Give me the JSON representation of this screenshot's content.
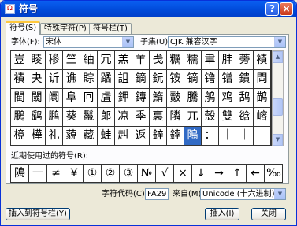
{
  "window": {
    "title": "符号"
  },
  "tabs": [
    {
      "label": "符号(S)"
    },
    {
      "label": "特殊字符(P)"
    },
    {
      "label": "符号栏(T)"
    }
  ],
  "font": {
    "label": "字体(F):",
    "value": "宋体"
  },
  "subset": {
    "label": "子集(U):",
    "value": "CJK 兼容汉字"
  },
  "grid": [
    [
      "豈",
      "睖",
      "穇",
      "竺",
      "紬",
      "冗",
      "羔",
      "羊",
      "戋",
      "糲",
      "糯",
      "聿",
      "肨",
      "蒡",
      "襀"
    ],
    [
      "襀",
      "夬",
      "䜣",
      "谯",
      "賩",
      "蹫",
      "詛",
      "鏑",
      "鈨",
      "铵",
      "镝",
      "镥",
      "镨",
      "鐀",
      "閊"
    ],
    [
      "閵",
      "閾",
      "阛",
      "阜",
      "冋",
      "虘",
      "鉀",
      "鏄",
      "鰖",
      "皾",
      "騰",
      "鸼",
      "鸡",
      "鸹",
      "鹋"
    ],
    [
      "鵩",
      "鹞",
      "鹏",
      "葵",
      "鬣",
      "郎",
      "凉",
      "季",
      "裏",
      "隣",
      "兀",
      "殼",
      "雙",
      "谽",
      "嵱"
    ],
    [
      "樈",
      "樺",
      "礼",
      "藐",
      "藏",
      "蛙",
      "赳",
      "返",
      "鋅",
      "鋍",
      "隝",
      "：",
      "｜",
      "｜",
      "｜"
    ]
  ],
  "recent": {
    "label": "近期使用过的符号(R):",
    "items": [
      "隝",
      "一",
      "≠",
      "￥",
      "①",
      "②",
      "③",
      "№",
      "√",
      "×",
      "↓",
      "→",
      "↑",
      "←",
      "‰"
    ]
  },
  "charcode": {
    "label": "字符代码(C):",
    "value": "FA29"
  },
  "from": {
    "label": "来自(M):",
    "value": "Unicode (十六进制)"
  },
  "buttons": {
    "insert_to_bar": "插入到符号栏(Y)",
    "insert": "插入(I)",
    "close": "关闭"
  },
  "selected": {
    "row": 4,
    "col": 10
  }
}
